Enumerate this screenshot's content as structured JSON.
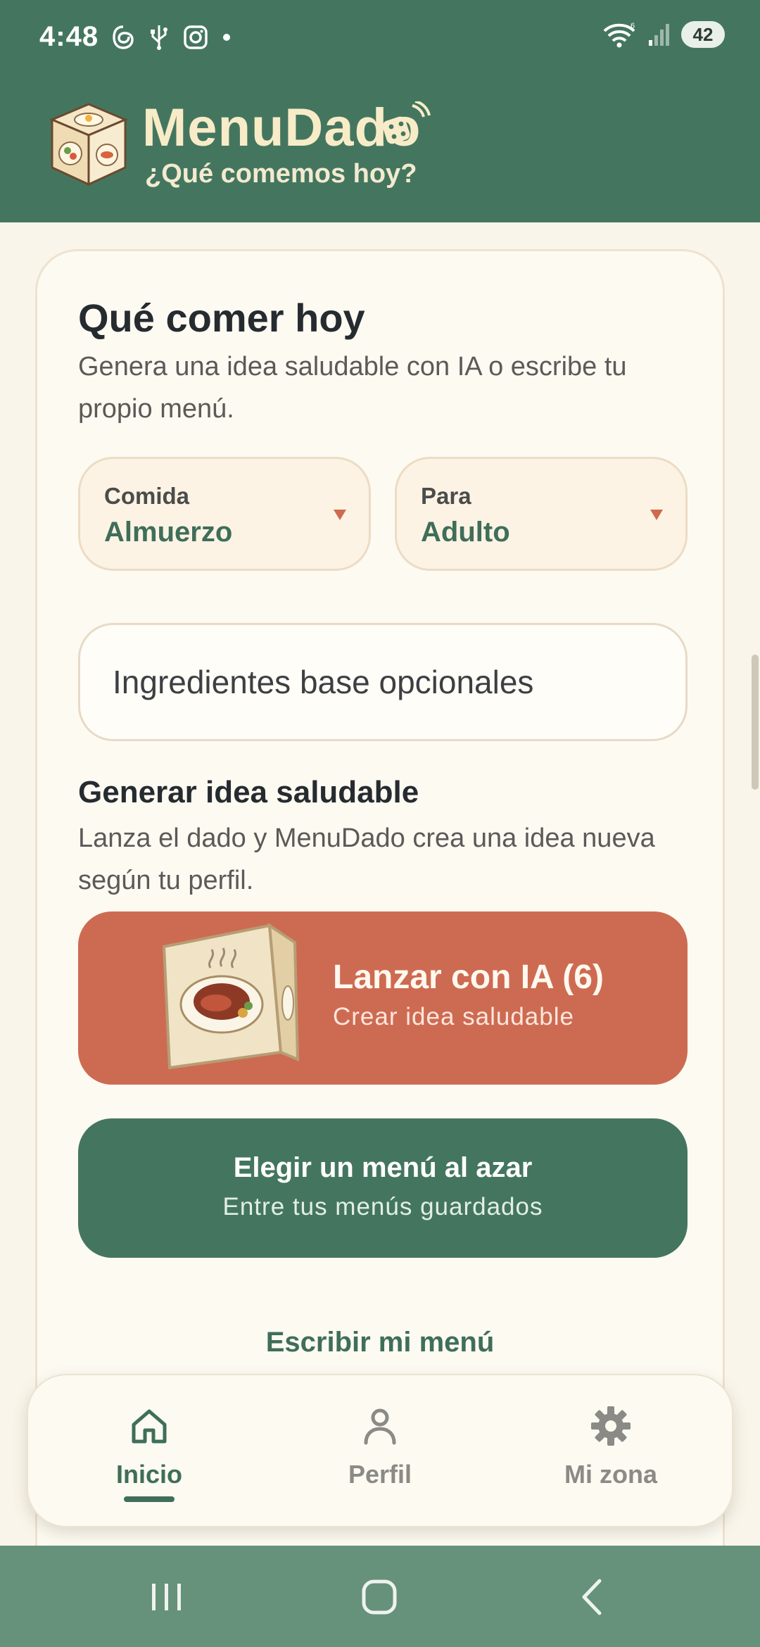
{
  "status_bar": {
    "time": "4:48",
    "battery": "42",
    "icons": [
      "threads-icon",
      "usb-icon",
      "instagram-icon",
      "dot-icon",
      "wifi-icon",
      "signal-icon",
      "battery-icon"
    ]
  },
  "header": {
    "title": "MenuDado",
    "subtitle": "¿Qué comemos hoy?"
  },
  "card": {
    "title": "Qué comer hoy",
    "description": "Genera una idea saludable con IA o escribe tu propio menú.",
    "meal_select": {
      "label": "Comida",
      "value": "Almuerzo"
    },
    "for_select": {
      "label": "Para",
      "value": "Adulto"
    },
    "ingredients_placeholder": "Ingredientes base opcionales",
    "generate": {
      "title": "Generar idea saludable",
      "description": "Lanza el dado y MenuDado crea una idea nueva según tu perfil."
    },
    "ai_button": {
      "label": "Lanzar con IA (6)",
      "sublabel": "Crear idea saludable"
    },
    "random_button": {
      "label": "Elegir un menú al azar",
      "sublabel": "Entre tus menús guardados"
    },
    "write_link": "Escribir mi menú"
  },
  "bottom_nav": {
    "items": [
      {
        "label": "Inicio",
        "icon": "home-icon",
        "active": true
      },
      {
        "label": "Perfil",
        "icon": "person-icon",
        "active": false
      },
      {
        "label": "Mi zona",
        "icon": "gear-icon",
        "active": false
      }
    ]
  },
  "colors": {
    "header_bg": "#44765f",
    "accent_terracotta": "#cd6b52",
    "accent_green": "#3f6e59",
    "page_bg": "#faf5ea"
  }
}
